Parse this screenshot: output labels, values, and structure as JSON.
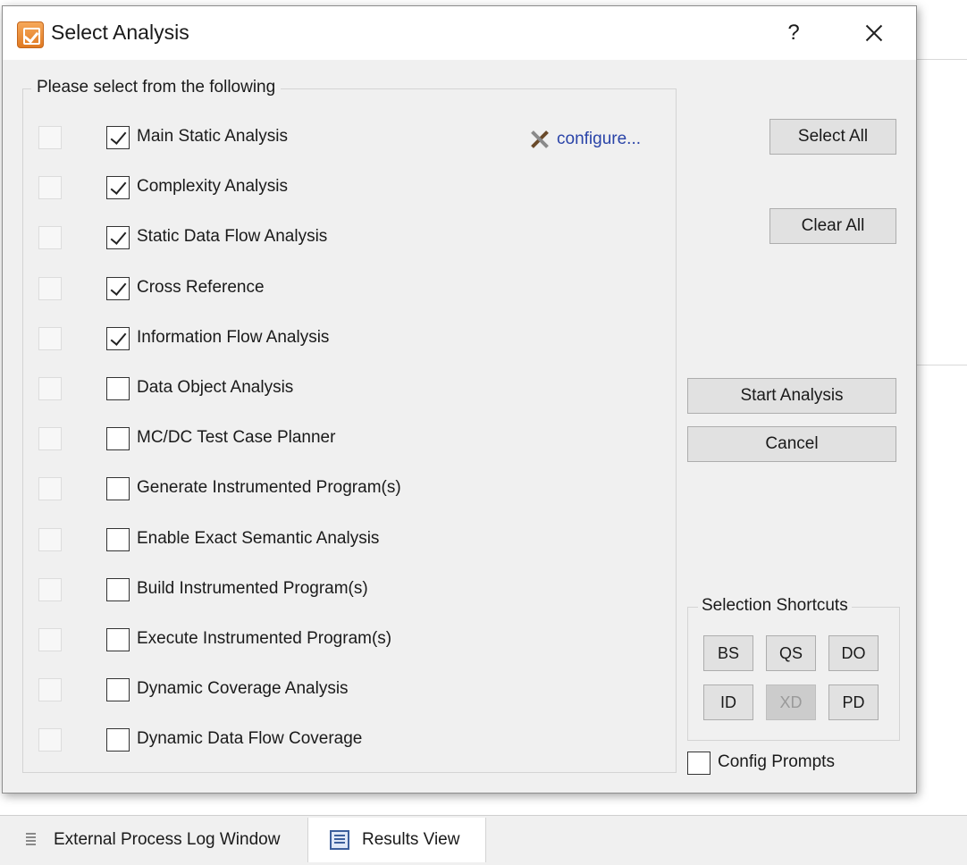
{
  "dialog": {
    "title": "Select Analysis",
    "help_label": "?",
    "group_title": "Please select from the following",
    "configure_label": "configure...",
    "analyses": [
      {
        "label": "Main Static Analysis",
        "checked": true
      },
      {
        "label": "Complexity Analysis",
        "checked": true
      },
      {
        "label": "Static Data Flow Analysis",
        "checked": true
      },
      {
        "label": "Cross Reference",
        "checked": true
      },
      {
        "label": "Information Flow Analysis",
        "checked": true
      },
      {
        "label": "Data Object Analysis",
        "checked": false
      },
      {
        "label": "MC/DC Test Case Planner",
        "checked": false
      },
      {
        "label": "Generate Instrumented Program(s)",
        "checked": false
      },
      {
        "label": "Enable Exact Semantic Analysis",
        "checked": false
      },
      {
        "label": "Build Instrumented Program(s)",
        "checked": false
      },
      {
        "label": "Execute Instrumented Program(s)",
        "checked": false
      },
      {
        "label": "Dynamic Coverage Analysis",
        "checked": false
      },
      {
        "label": "Dynamic Data Flow Coverage",
        "checked": false
      }
    ],
    "buttons": {
      "select_all": "Select All",
      "clear_all": "Clear All",
      "start_analysis": "Start Analysis",
      "cancel": "Cancel"
    },
    "shortcuts": {
      "title": "Selection Shortcuts",
      "items": [
        {
          "label": "BS",
          "enabled": true
        },
        {
          "label": "QS",
          "enabled": true
        },
        {
          "label": "DO",
          "enabled": true
        },
        {
          "label": "ID",
          "enabled": true
        },
        {
          "label": "XD",
          "enabled": false
        },
        {
          "label": "PD",
          "enabled": true
        }
      ]
    },
    "config_prompts": {
      "label": "Config Prompts",
      "checked": false
    }
  },
  "bottom_tabs": [
    {
      "label": "External Process Log Window",
      "active": false,
      "icon": "log-icon"
    },
    {
      "label": "Results View",
      "active": true,
      "icon": "results-view-icon"
    }
  ],
  "colors": {
    "dialog_bg": "#f0f0f0",
    "link": "#2a44a8",
    "button_bg": "#e1e1e1",
    "app_icon": "#e07a22"
  }
}
